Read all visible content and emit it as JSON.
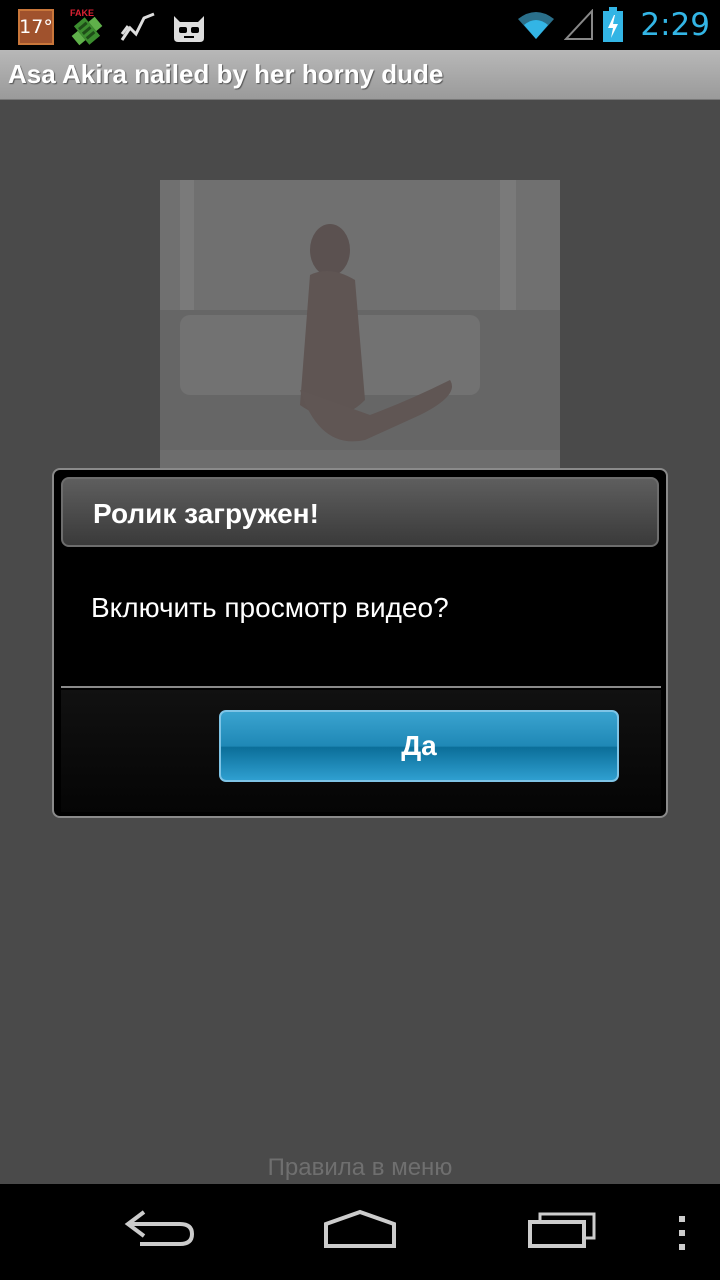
{
  "status_bar": {
    "temperature": "17°",
    "fake_badge": "FAKE",
    "time": "2:29",
    "icons": [
      "temperature-icon",
      "fake-gps-icon",
      "activity-icon",
      "cyanogenmod-icon",
      "wifi-icon",
      "signal-icon",
      "battery-charging-icon"
    ]
  },
  "title_bar": {
    "title": "Asa Akira nailed by her horny dude"
  },
  "content": {
    "thumbnail": "video-thumbnail",
    "footer_link": "Правила в меню"
  },
  "dialog": {
    "title": "Ролик загружен!",
    "message": "Включить просмотр видео?",
    "button_label": "Да"
  },
  "nav_bar": {
    "buttons": [
      "back-icon",
      "home-icon",
      "recent-apps-icon",
      "menu-icon"
    ]
  }
}
